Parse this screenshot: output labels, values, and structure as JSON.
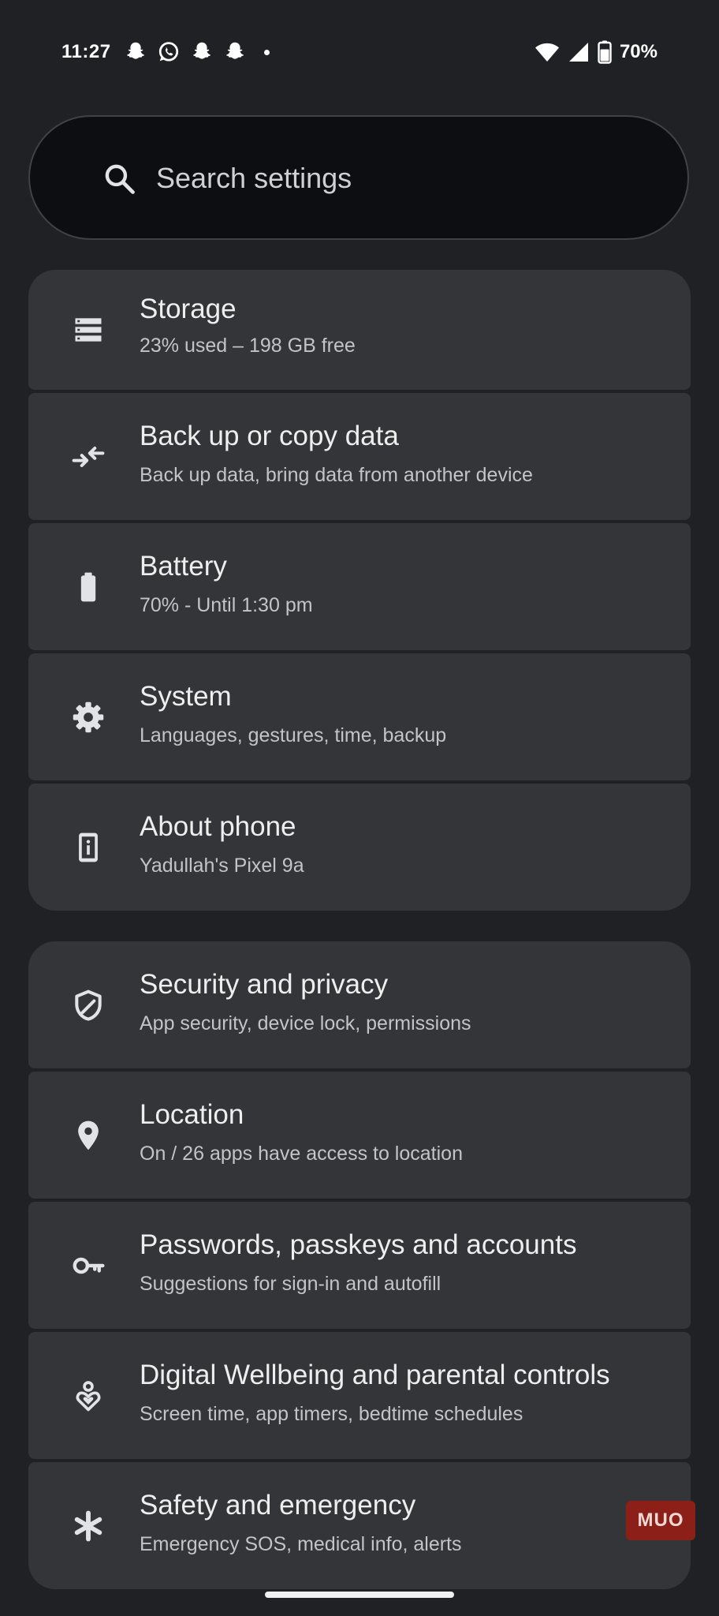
{
  "status_bar": {
    "time": "11:27",
    "notification_icons": [
      "snapchat-icon",
      "whatsapp-icon",
      "snapchat-icon",
      "snapchat-icon"
    ],
    "battery_percent": "70%",
    "battery_level": 0.7
  },
  "search": {
    "placeholder": "Search settings"
  },
  "group1": [
    {
      "icon": "storage-icon",
      "title": "Storage",
      "subtitle": "23% used – 198 GB free"
    },
    {
      "icon": "backup-transfer-icon",
      "title": "Back up or copy data",
      "subtitle": "Back up data, bring data from another device"
    },
    {
      "icon": "battery-icon",
      "title": "Battery",
      "subtitle": "70% - Until 1:30 pm"
    },
    {
      "icon": "gear-icon",
      "title": "System",
      "subtitle": "Languages, gestures, time, backup"
    },
    {
      "icon": "phone-info-icon",
      "title": "About phone",
      "subtitle": "Yadullah's Pixel 9a"
    }
  ],
  "group2": [
    {
      "icon": "shield-icon",
      "title": "Security and privacy",
      "subtitle": "App security, device lock, permissions"
    },
    {
      "icon": "location-pin-icon",
      "title": "Location",
      "subtitle": "On / 26 apps have access to location"
    },
    {
      "icon": "key-icon",
      "title": "Passwords, passkeys and accounts",
      "subtitle": "Suggestions for sign-in and autofill"
    },
    {
      "icon": "wellbeing-icon",
      "title": "Digital Wellbeing and parental controls",
      "subtitle": "Screen time, app timers, bedtime schedules"
    },
    {
      "icon": "asterisk-icon",
      "title": "Safety and emergency",
      "subtitle": "Emergency SOS, medical info, alerts"
    }
  ],
  "watermark": {
    "text": "MUO"
  },
  "colors": {
    "background": "#202124",
    "card": "#333539",
    "search_background": "#0d0e11",
    "icon": "#e2e3e6",
    "watermark": "#8c2018"
  }
}
